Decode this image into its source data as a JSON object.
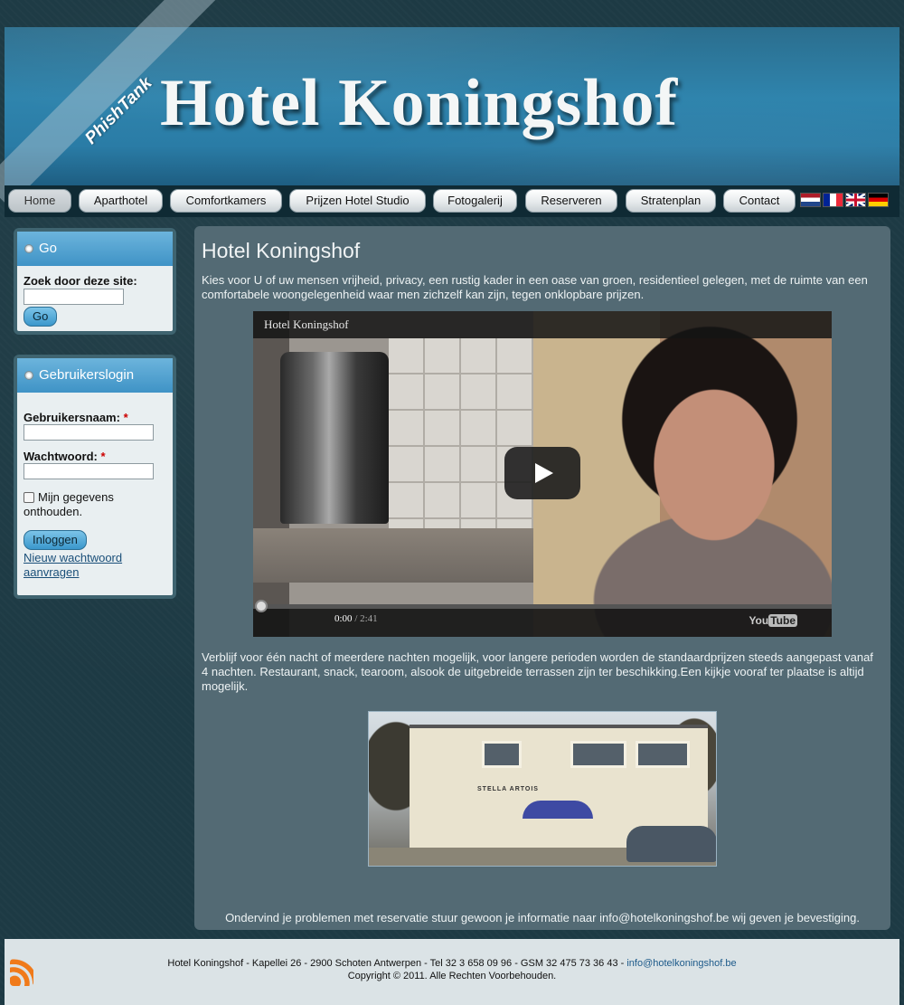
{
  "header": {
    "site_title": "Hotel Koningshof",
    "watermark": "PhishTank"
  },
  "nav": {
    "items": [
      {
        "label": "Home",
        "active": true
      },
      {
        "label": "Aparthotel",
        "active": false
      },
      {
        "label": "Comfortkamers",
        "active": false
      },
      {
        "label": "Prijzen Hotel Studio",
        "active": false
      },
      {
        "label": "Fotogalerij",
        "active": false
      },
      {
        "label": "Reserveren",
        "active": false
      },
      {
        "label": "Stratenplan",
        "active": false
      },
      {
        "label": "Contact",
        "active": false
      }
    ],
    "flags": [
      "flag-netherlands-icon",
      "flag-france-icon",
      "flag-uk-icon",
      "flag-germany-icon"
    ]
  },
  "search_module": {
    "title": "Go",
    "label": "Zoek door deze site:",
    "value": "",
    "button": "Go"
  },
  "login_module": {
    "title": "Gebruikerslogin",
    "username_label": "Gebruikersnaam:",
    "password_label": "Wachtwoord:",
    "required_mark": "*",
    "remember_label": "Mijn gegevens onthouden.",
    "remember_checked": false,
    "login_button": "Inloggen",
    "forgot_link": "Nieuw wachtwoord aanvragen"
  },
  "main": {
    "title": "Hotel Koningshof",
    "intro": "Kies voor U of uw mensen vrijheid, privacy, een rustig kader in een oase van groen, residentieel gelegen, met de ruimte van een comfortabele woongelegenheid waar men zichzelf kan zijn, tegen onklopbare prijzen.",
    "video": {
      "title": "Hotel Koningshof",
      "current_time": "0:00",
      "duration": "/ 2:41",
      "brand_you": "You",
      "brand_tube": "Tube"
    },
    "stay_text": "Verblijf voor één nacht of meerdere nachten mogelijk, voor langere perioden worden de standaardprijzen steeds aangepast vanaf 4 nachten. Restaurant, snack, tearoom, alsook de uitgebreide terrassen zijn ter beschikking.Een kijkje vooraf ter plaatse is altijd mogelijk.",
    "photo_sign": "STELLA ARTOIS",
    "contact_text": "Ondervind je problemen met reservatie stuur gewoon je informatie naar info@hotelkoningshof.be wij geven je bevestiging."
  },
  "footer": {
    "address": "Hotel Koningshof - Kapellei 26 - 2900 Schoten Antwerpen - Tel 32 3 658 09 96 - GSM 32 475 73 36 43 - ",
    "email": "info@hotelkoningshof.be",
    "copyright": "Copyright © 2011. Alle Rechten Voorbehouden."
  }
}
